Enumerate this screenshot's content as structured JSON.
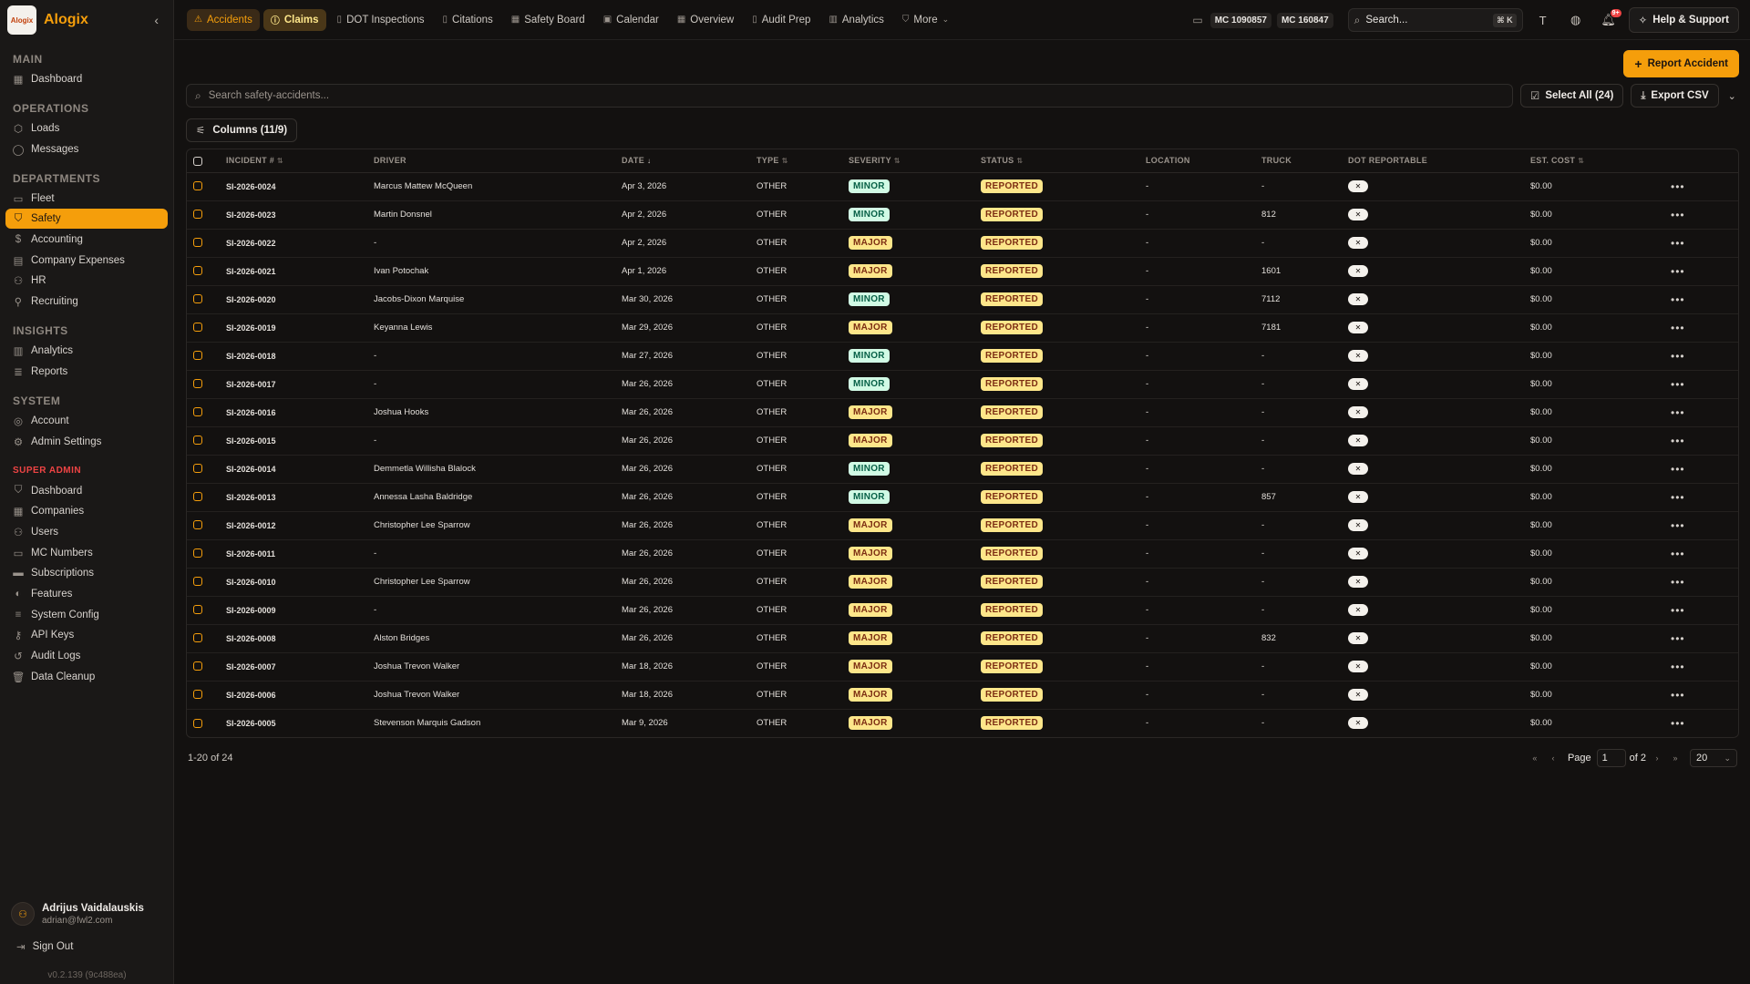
{
  "brand": {
    "logo_text": "Alogix",
    "name": "Alogix"
  },
  "sidebar": {
    "sections": [
      {
        "title": "MAIN",
        "super": false,
        "items": [
          {
            "label": "Dashboard",
            "icon": "grid-icon",
            "glyph": "▦",
            "active": false
          }
        ]
      },
      {
        "title": "OPERATIONS",
        "super": false,
        "items": [
          {
            "label": "Loads",
            "icon": "package-icon",
            "glyph": "⬡",
            "active": false
          },
          {
            "label": "Messages",
            "icon": "message-icon",
            "glyph": "◯",
            "active": false
          }
        ]
      },
      {
        "title": "DEPARTMENTS",
        "super": false,
        "items": [
          {
            "label": "Fleet",
            "icon": "truck-icon",
            "glyph": "▭",
            "active": false
          },
          {
            "label": "Safety",
            "icon": "shield-icon",
            "glyph": "⛉",
            "active": true
          },
          {
            "label": "Accounting",
            "icon": "dollar-icon",
            "glyph": "$",
            "active": false
          },
          {
            "label": "Company Expenses",
            "icon": "receipt-icon",
            "glyph": "▤",
            "active": false
          },
          {
            "label": "HR",
            "icon": "users-icon",
            "glyph": "⚇",
            "active": false
          },
          {
            "label": "Recruiting",
            "icon": "user-plus-icon",
            "glyph": "⚲",
            "active": false
          }
        ]
      },
      {
        "title": "INSIGHTS",
        "super": false,
        "items": [
          {
            "label": "Analytics",
            "icon": "bar-chart-icon",
            "glyph": "▥",
            "active": false
          },
          {
            "label": "Reports",
            "icon": "report-icon",
            "glyph": "≣",
            "active": false
          }
        ]
      },
      {
        "title": "SYSTEM",
        "super": false,
        "items": [
          {
            "label": "Account",
            "icon": "account-icon",
            "glyph": "◎",
            "active": false
          },
          {
            "label": "Admin Settings",
            "icon": "gear-icon",
            "glyph": "⚙",
            "active": false
          }
        ]
      },
      {
        "title": "SUPER ADMIN",
        "super": true,
        "items": [
          {
            "label": "Dashboard",
            "icon": "shield-icon",
            "glyph": "⛉",
            "active": false
          },
          {
            "label": "Companies",
            "icon": "building-icon",
            "glyph": "▦",
            "active": false
          },
          {
            "label": "Users",
            "icon": "users-icon",
            "glyph": "⚇",
            "active": false
          },
          {
            "label": "MC Numbers",
            "icon": "truck-icon",
            "glyph": "▭",
            "active": false
          },
          {
            "label": "Subscriptions",
            "icon": "credit-card-icon",
            "glyph": "▬",
            "active": false
          },
          {
            "label": "Features",
            "icon": "toggle-icon",
            "glyph": "◐",
            "active": false
          },
          {
            "label": "System Config",
            "icon": "sliders-icon",
            "glyph": "≡",
            "active": false
          },
          {
            "label": "API Keys",
            "icon": "key-icon",
            "glyph": "⚷",
            "active": false
          },
          {
            "label": "Audit Logs",
            "icon": "history-icon",
            "glyph": "↺",
            "active": false
          },
          {
            "label": "Data Cleanup",
            "icon": "trash-icon",
            "glyph": "🗑",
            "active": false
          }
        ]
      }
    ]
  },
  "user": {
    "name": "Adrijus Vaidalauskis",
    "email": "adrian@fwl2.com"
  },
  "signout_label": "Sign Out",
  "version": "v0.2.139 (9c488ea)",
  "topnav": {
    "tabs": [
      {
        "label": "Accidents",
        "icon": "alert-triangle-icon",
        "glyph": "⚠",
        "state": "active"
      },
      {
        "label": "Claims",
        "icon": "alert-circle-icon",
        "glyph": "ⓘ",
        "state": "active2"
      },
      {
        "label": "DOT Inspections",
        "icon": "file-icon",
        "glyph": "▯",
        "state": ""
      },
      {
        "label": "Citations",
        "icon": "file-icon",
        "glyph": "▯",
        "state": ""
      },
      {
        "label": "Safety Board",
        "icon": "board-icon",
        "glyph": "▦",
        "state": ""
      },
      {
        "label": "Calendar",
        "icon": "calendar-icon",
        "glyph": "▣",
        "state": ""
      },
      {
        "label": "Overview",
        "icon": "grid-icon",
        "glyph": "▦",
        "state": ""
      },
      {
        "label": "Audit Prep",
        "icon": "clipboard-icon",
        "glyph": "▯",
        "state": ""
      },
      {
        "label": "Analytics",
        "icon": "bar-chart-icon",
        "glyph": "▥",
        "state": ""
      },
      {
        "label": "More",
        "icon": "shield-icon",
        "glyph": "⛉",
        "state": "",
        "chevron": true
      }
    ],
    "mc_numbers": [
      "MC 1090857",
      "MC 160847"
    ],
    "search_placeholder": "Search...",
    "search_kbd": "⌘ K",
    "notif_count": "9+",
    "help_label": "Help & Support"
  },
  "toolbar": {
    "report_label": "Report Accident",
    "search_placeholder": "Search safety-accidents...",
    "select_all_label": "Select All (24)",
    "export_label": "Export CSV",
    "columns_label": "Columns (11/9)"
  },
  "table": {
    "headers": [
      "INCIDENT #",
      "DRIVER",
      "DATE",
      "TYPE",
      "SEVERITY",
      "STATUS",
      "LOCATION",
      "TRUCK",
      "DOT REPORTABLE",
      "EST. COST"
    ],
    "rows": [
      {
        "id": "SI-2026-0024",
        "driver": "Marcus Mattew McQueen",
        "date": "Apr 3, 2026",
        "type": "OTHER",
        "severity": "MINOR",
        "status": "REPORTED",
        "location": "-",
        "truck": "-",
        "dot": "✕",
        "cost": "$0.00"
      },
      {
        "id": "SI-2026-0023",
        "driver": "Martin Donsnel",
        "date": "Apr 2, 2026",
        "type": "OTHER",
        "severity": "MINOR",
        "status": "REPORTED",
        "location": "-",
        "truck": "812",
        "dot": "✕",
        "cost": "$0.00"
      },
      {
        "id": "SI-2026-0022",
        "driver": "-",
        "date": "Apr 2, 2026",
        "type": "OTHER",
        "severity": "MAJOR",
        "status": "REPORTED",
        "location": "-",
        "truck": "-",
        "dot": "✕",
        "cost": "$0.00"
      },
      {
        "id": "SI-2026-0021",
        "driver": "Ivan Potochak",
        "date": "Apr 1, 2026",
        "type": "OTHER",
        "severity": "MAJOR",
        "status": "REPORTED",
        "location": "-",
        "truck": "1601",
        "dot": "✕",
        "cost": "$0.00"
      },
      {
        "id": "SI-2026-0020",
        "driver": "Jacobs-Dixon Marquise",
        "date": "Mar 30, 2026",
        "type": "OTHER",
        "severity": "MINOR",
        "status": "REPORTED",
        "location": "-",
        "truck": "7112",
        "dot": "✕",
        "cost": "$0.00"
      },
      {
        "id": "SI-2026-0019",
        "driver": "Keyanna Lewis",
        "date": "Mar 29, 2026",
        "type": "OTHER",
        "severity": "MAJOR",
        "status": "REPORTED",
        "location": "-",
        "truck": "7181",
        "dot": "✕",
        "cost": "$0.00"
      },
      {
        "id": "SI-2026-0018",
        "driver": "-",
        "date": "Mar 27, 2026",
        "type": "OTHER",
        "severity": "MINOR",
        "status": "REPORTED",
        "location": "-",
        "truck": "-",
        "dot": "✕",
        "cost": "$0.00"
      },
      {
        "id": "SI-2026-0017",
        "driver": "-",
        "date": "Mar 26, 2026",
        "type": "OTHER",
        "severity": "MINOR",
        "status": "REPORTED",
        "location": "-",
        "truck": "-",
        "dot": "✕",
        "cost": "$0.00"
      },
      {
        "id": "SI-2026-0016",
        "driver": "Joshua Hooks",
        "date": "Mar 26, 2026",
        "type": "OTHER",
        "severity": "MAJOR",
        "status": "REPORTED",
        "location": "-",
        "truck": "-",
        "dot": "✕",
        "cost": "$0.00"
      },
      {
        "id": "SI-2026-0015",
        "driver": "-",
        "date": "Mar 26, 2026",
        "type": "OTHER",
        "severity": "MAJOR",
        "status": "REPORTED",
        "location": "-",
        "truck": "-",
        "dot": "✕",
        "cost": "$0.00"
      },
      {
        "id": "SI-2026-0014",
        "driver": "Demmetla Willisha Blalock",
        "date": "Mar 26, 2026",
        "type": "OTHER",
        "severity": "MINOR",
        "status": "REPORTED",
        "location": "-",
        "truck": "-",
        "dot": "✕",
        "cost": "$0.00"
      },
      {
        "id": "SI-2026-0013",
        "driver": "Annessa Lasha Baldridge",
        "date": "Mar 26, 2026",
        "type": "OTHER",
        "severity": "MINOR",
        "status": "REPORTED",
        "location": "-",
        "truck": "857",
        "dot": "✕",
        "cost": "$0.00"
      },
      {
        "id": "SI-2026-0012",
        "driver": "Christopher Lee Sparrow",
        "date": "Mar 26, 2026",
        "type": "OTHER",
        "severity": "MAJOR",
        "status": "REPORTED",
        "location": "-",
        "truck": "-",
        "dot": "✕",
        "cost": "$0.00"
      },
      {
        "id": "SI-2026-0011",
        "driver": "-",
        "date": "Mar 26, 2026",
        "type": "OTHER",
        "severity": "MAJOR",
        "status": "REPORTED",
        "location": "-",
        "truck": "-",
        "dot": "✕",
        "cost": "$0.00"
      },
      {
        "id": "SI-2026-0010",
        "driver": "Christopher Lee Sparrow",
        "date": "Mar 26, 2026",
        "type": "OTHER",
        "severity": "MAJOR",
        "status": "REPORTED",
        "location": "-",
        "truck": "-",
        "dot": "✕",
        "cost": "$0.00"
      },
      {
        "id": "SI-2026-0009",
        "driver": "-",
        "date": "Mar 26, 2026",
        "type": "OTHER",
        "severity": "MAJOR",
        "status": "REPORTED",
        "location": "-",
        "truck": "-",
        "dot": "✕",
        "cost": "$0.00"
      },
      {
        "id": "SI-2026-0008",
        "driver": "Alston Bridges",
        "date": "Mar 26, 2026",
        "type": "OTHER",
        "severity": "MAJOR",
        "status": "REPORTED",
        "location": "-",
        "truck": "832",
        "dot": "✕",
        "cost": "$0.00"
      },
      {
        "id": "SI-2026-0007",
        "driver": "Joshua Trevon Walker",
        "date": "Mar 18, 2026",
        "type": "OTHER",
        "severity": "MAJOR",
        "status": "REPORTED",
        "location": "-",
        "truck": "-",
        "dot": "✕",
        "cost": "$0.00"
      },
      {
        "id": "SI-2026-0006",
        "driver": "Joshua Trevon Walker",
        "date": "Mar 18, 2026",
        "type": "OTHER",
        "severity": "MAJOR",
        "status": "REPORTED",
        "location": "-",
        "truck": "-",
        "dot": "✕",
        "cost": "$0.00"
      },
      {
        "id": "SI-2026-0005",
        "driver": "Stevenson Marquis Gadson",
        "date": "Mar 9, 2026",
        "type": "OTHER",
        "severity": "MAJOR",
        "status": "REPORTED",
        "location": "-",
        "truck": "-",
        "dot": "✕",
        "cost": "$0.00"
      }
    ]
  },
  "pagination": {
    "range_text": "1-20 of 24",
    "page_label": "Page",
    "page_value": "1",
    "of_text": "of 2",
    "page_size": "20"
  },
  "colors": {
    "accent": "#f59e0b",
    "bg": "#131110",
    "minor_bg": "#d1fae5",
    "major_bg": "#fde68a"
  }
}
